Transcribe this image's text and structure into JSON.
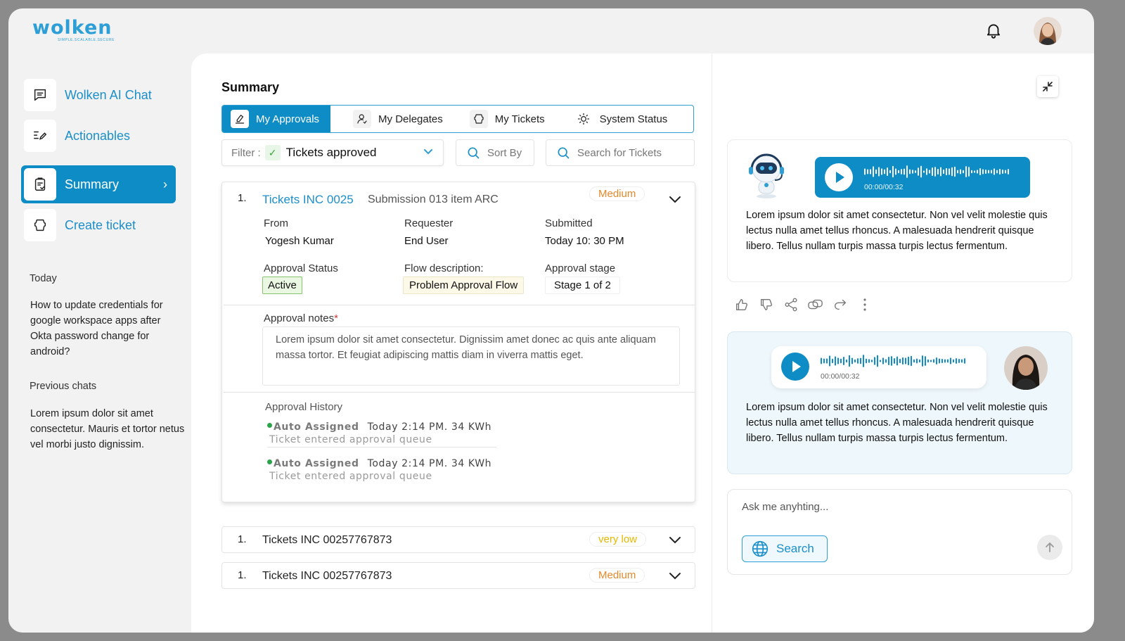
{
  "brand": {
    "logo_text": "wolken",
    "tagline": "SIMPLE.SCALABLE.SECURE"
  },
  "header": {
    "notification_icon": "bell-icon",
    "profile_icon": "avatar"
  },
  "sidebar": {
    "items": [
      {
        "label": "Wolken AI Chat",
        "icon": "chat-icon"
      },
      {
        "label": "Actionables",
        "icon": "list-edit-icon"
      },
      {
        "label": "Summary",
        "icon": "clipboard-check-icon",
        "active": true
      },
      {
        "label": "Create ticket",
        "icon": "ticket-icon"
      }
    ],
    "today_heading": "Today",
    "today_chat": "How to update credentials for google workspace apps after Okta password change for android?",
    "previous_heading": "Previous chats",
    "previous_chat": "Lorem ipsum dolor sit amet consectetur. Mauris et tortor netus vel morbi justo dignissim."
  },
  "main": {
    "title": "Summary",
    "tabs": [
      {
        "label": "My Approvals",
        "icon": "approval-icon",
        "active": true
      },
      {
        "label": "My Delegates",
        "icon": "user-check-icon"
      },
      {
        "label": "My Tickets",
        "icon": "ticket-icon"
      },
      {
        "label": "System Status",
        "icon": "sun-gear-icon"
      }
    ],
    "filter": {
      "label": "Filter :",
      "value": "Tickets approved"
    },
    "sort_label": "Sort By",
    "search_placeholder": "Search for Tickets",
    "expanded_ticket": {
      "number": "1.",
      "title": "Tickets INC 0025",
      "subtitle": "Submission 013 item ARC",
      "priority": "Medium",
      "from_label": "From",
      "from_value": "Yogesh Kumar",
      "requester_label": "Requester",
      "requester_value": "End User",
      "submitted_label": "Submitted",
      "submitted_value": "Today 10: 30 PM",
      "status_label": "Approval Status",
      "status_value": "Active",
      "flow_label": "Flow description:",
      "flow_value": "Problem Approval Flow",
      "stage_label": "Approval stage",
      "stage_value": "Stage 1 of 2",
      "notes_label": "Approval notes",
      "notes_required": "*",
      "notes_text": "Lorem ipsum dolor sit amet consectetur. Dignissim amet donec ac quis ante aliquam massa tortor. Et feugiat adipiscing mattis diam in viverra mattis eget.",
      "history_title": "Approval History",
      "history": [
        {
          "actor": "Auto Assigned",
          "time": "Today 2:14 PM. 34 KWh",
          "desc": "Ticket entered approval queue"
        },
        {
          "actor": "Auto Assigned",
          "time": "Today 2:14 PM. 34 KWh",
          "desc": "Ticket entered approval queue"
        }
      ]
    },
    "collapsed_tickets": [
      {
        "number": "1.",
        "title": "Tickets INC 00257767873",
        "priority": "very low"
      },
      {
        "number": "1.",
        "title": "Tickets INC 00257767873",
        "priority": "Medium"
      }
    ]
  },
  "chat": {
    "collapse_icon": "collapse-icon",
    "bot_message": {
      "audio_time": "00:00/00:32",
      "text": "Lorem ipsum dolor sit amet consectetur. Non vel velit molestie quis lectus nulla amet tellus rhoncus. A malesuada hendrerit quisque libero. Tellus nullam turpis massa turpis lectus fermentum."
    },
    "message_actions": [
      "thumbs-up-icon",
      "thumbs-down-icon",
      "share-icon",
      "copy-icon",
      "redo-icon",
      "more-icon"
    ],
    "user_message": {
      "audio_time": "00:00/00:32",
      "text": "Lorem ipsum dolor sit amet consectetur. Non vel velit molestie quis lectus nulla amet tellus rhoncus. A malesuada hendrerit quisque libero. Tellus nullam turpis massa turpis lectus fermentum."
    },
    "input_placeholder": "Ask me anyhting...",
    "search_button": "Search",
    "send_icon": "arrow-up-icon"
  },
  "colors": {
    "accent": "#0d8cc6",
    "medium": "#e3892a",
    "low": "#e6b800",
    "active_green": "#86c36c"
  }
}
